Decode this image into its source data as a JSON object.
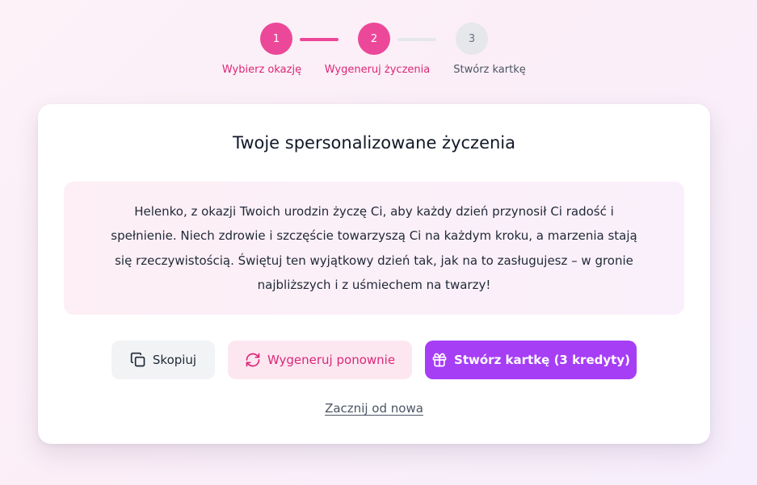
{
  "stepper": {
    "steps": [
      {
        "number": "1",
        "label": "Wybierz okazję",
        "state": "done"
      },
      {
        "number": "2",
        "label": "Wygeneruj życzenia",
        "state": "current"
      },
      {
        "number": "3",
        "label": "Stwórz kartkę",
        "state": "todo"
      }
    ]
  },
  "card": {
    "title": "Twoje spersonalizowane życzenia",
    "message": "Helenko, z okazji Twoich urodzin życzę Ci, aby każdy dzień przynosił Ci radość i spełnienie. Niech zdrowie i szczęście towarzyszą Ci na każdym kroku, a marzenia stają się rzeczywistością. Świętuj ten wyjątkowy dzień tak, jak na to zasługujesz – w gronie najbliższych i z uśmiechem na twarzy!"
  },
  "actions": {
    "copy_label": "Skopiuj",
    "copy_icon": "copy-icon",
    "regenerate_label": "Wygeneruj ponownie",
    "regenerate_icon": "refresh-icon",
    "create_label": "Stwórz kartkę (3 kredyty)",
    "create_icon": "gift-icon",
    "restart_label": "Zacznij od nowa"
  },
  "colors": {
    "accent_pink": "#ec4899",
    "accent_purple": "#a63ef5",
    "inactive_gray": "#e5e7eb"
  }
}
